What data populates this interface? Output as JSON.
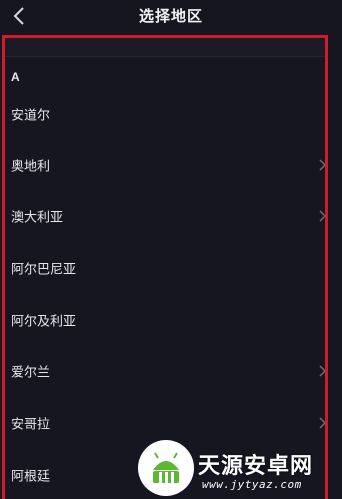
{
  "header": {
    "title": "选择地区",
    "back_icon": "chevron-left-icon"
  },
  "section": {
    "letter": "A"
  },
  "regions": [
    {
      "label": "安道尔",
      "has_chevron": false
    },
    {
      "label": "奥地利",
      "has_chevron": true
    },
    {
      "label": "澳大利亚",
      "has_chevron": true
    },
    {
      "label": "阿尔巴尼亚",
      "has_chevron": false
    },
    {
      "label": "阿尔及利亚",
      "has_chevron": false
    },
    {
      "label": "爱尔兰",
      "has_chevron": true
    },
    {
      "label": "安哥拉",
      "has_chevron": true
    },
    {
      "label": "阿根廷",
      "has_chevron": false
    }
  ],
  "watermark": {
    "name": "天源安卓网",
    "url": "www.jytyaz.com",
    "logo": "android-logo-icon"
  },
  "colors": {
    "background": "#161621",
    "highlight": "#d21b2a",
    "text": "#e6e6ec",
    "watermark_green": "#5cb832"
  }
}
